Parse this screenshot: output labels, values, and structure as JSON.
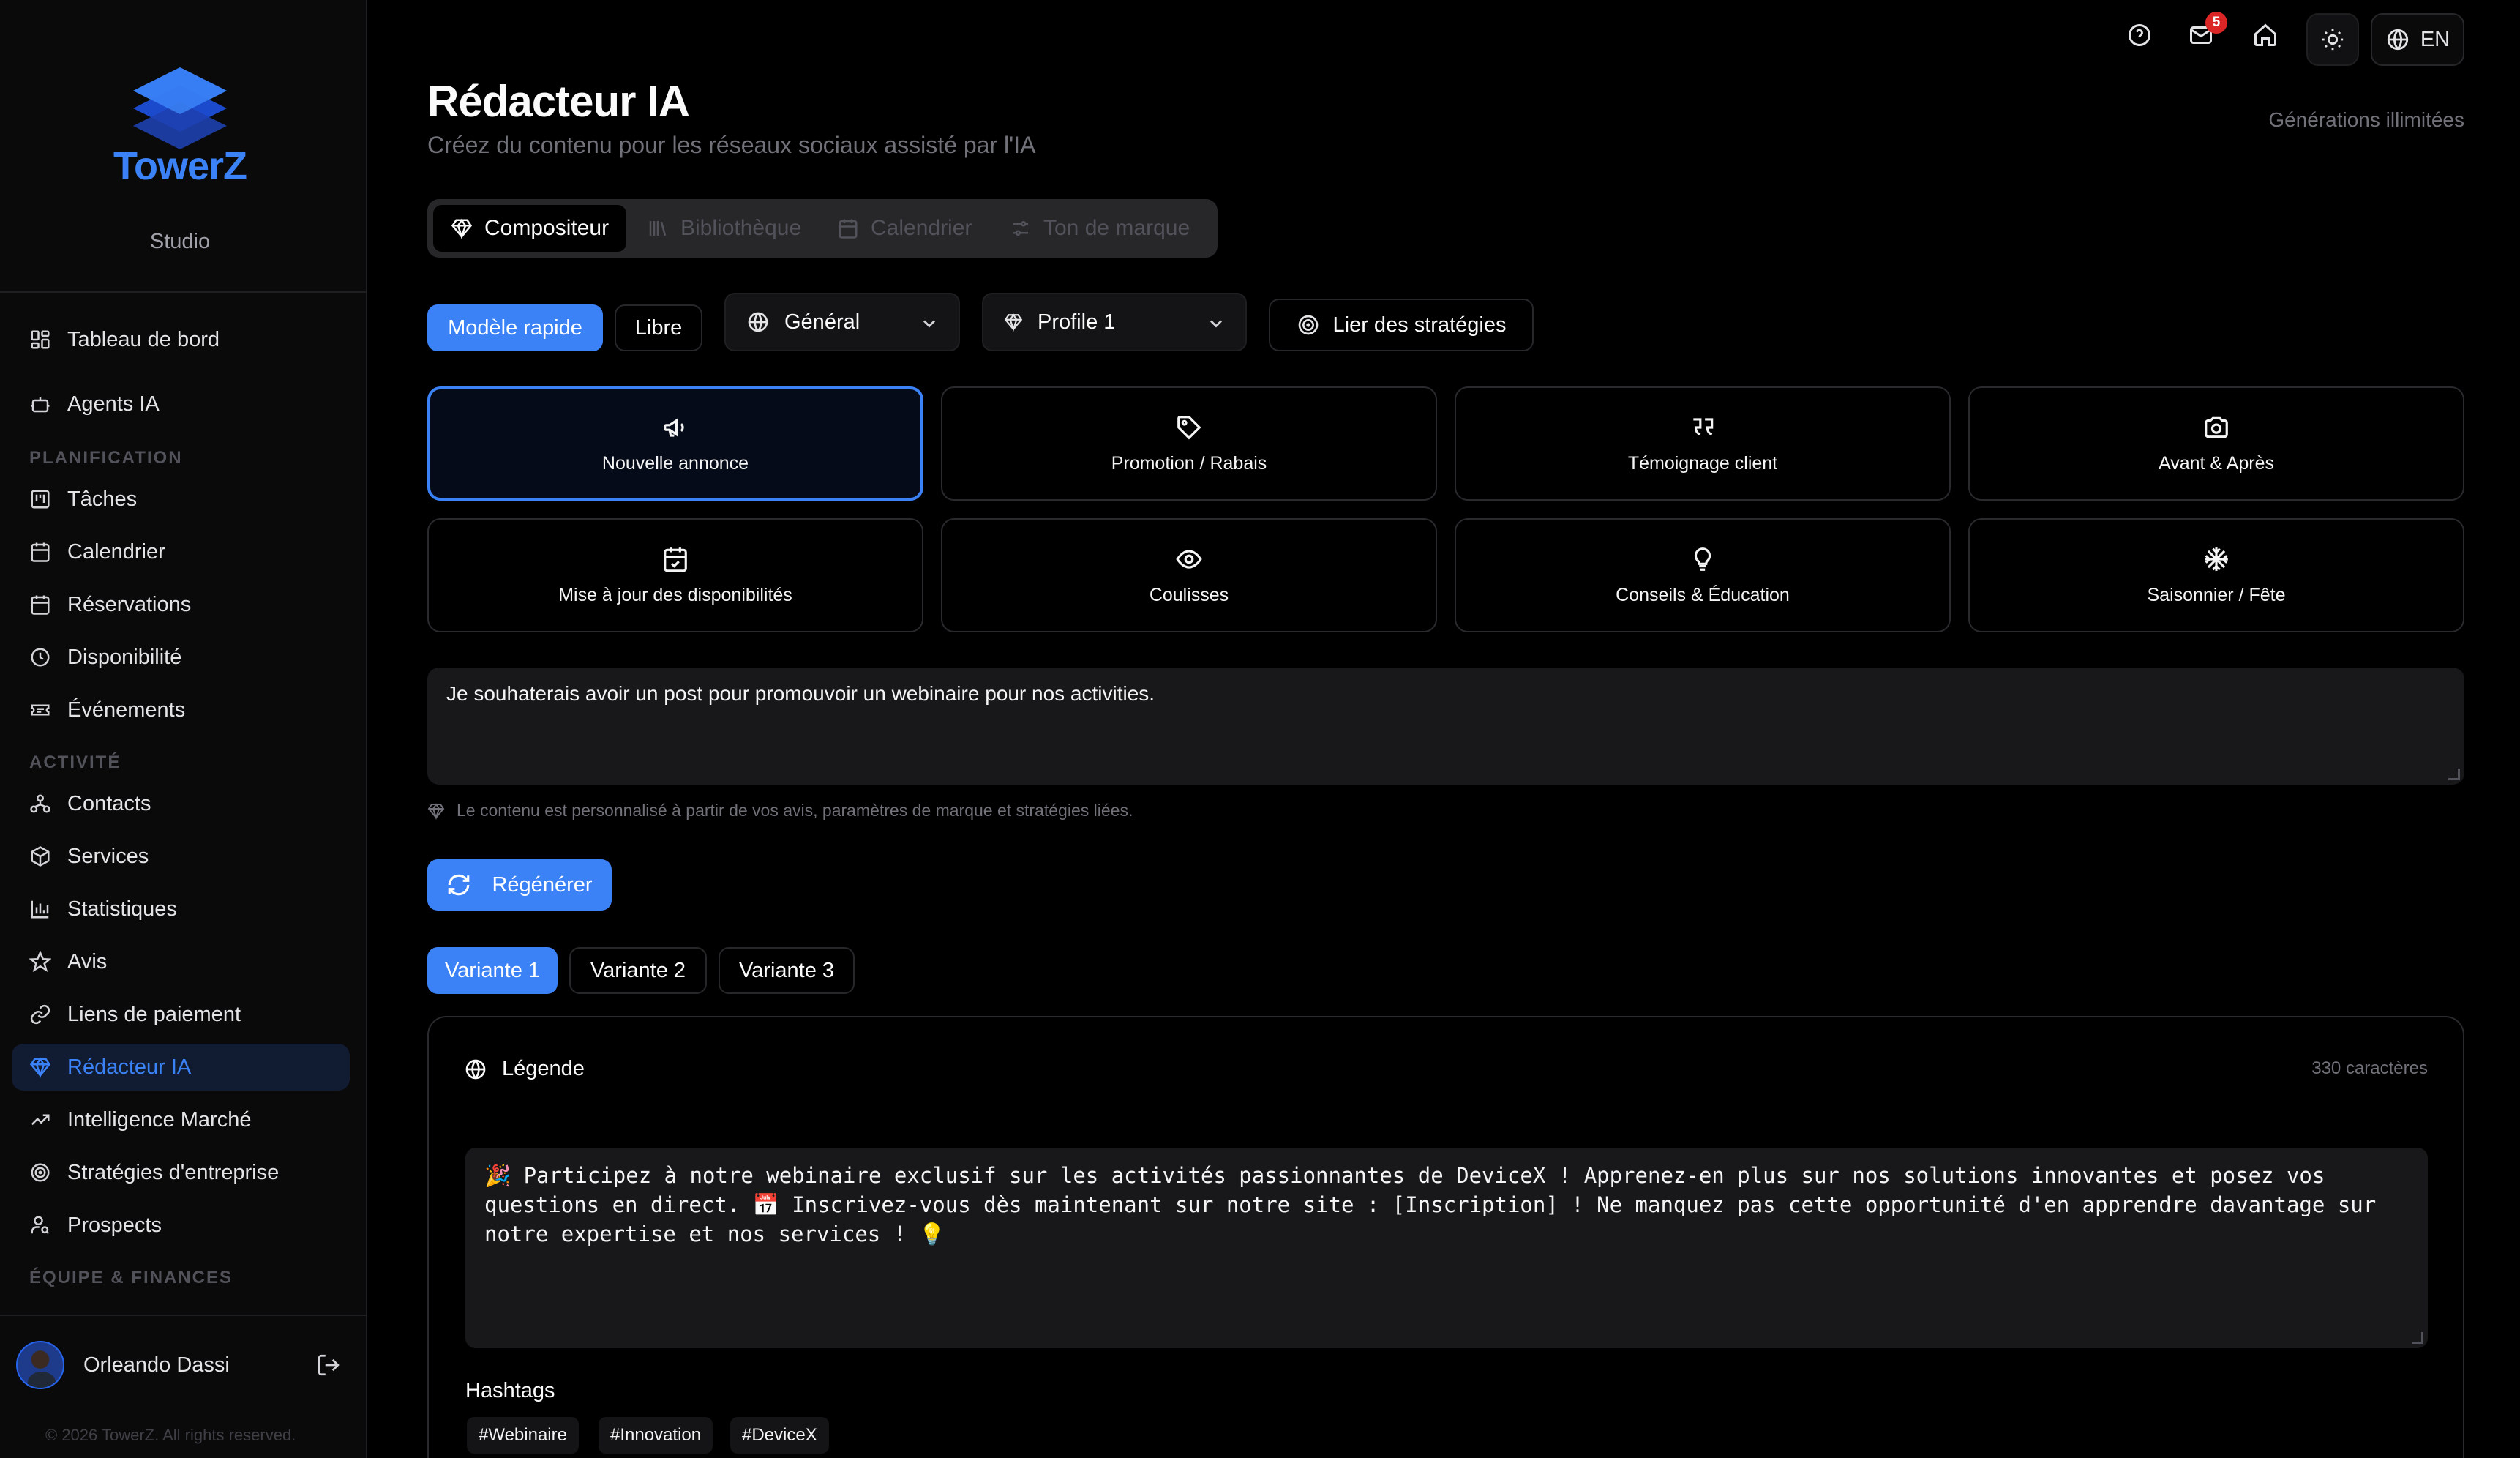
{
  "app": {
    "name": "TowerZ",
    "subtitle": "Studio",
    "copyright": "© 2026 TowerZ. All rights reserved.",
    "brand_color": "#3b82f6"
  },
  "topbar": {
    "notification_count": "5",
    "language": "EN"
  },
  "sidebar": {
    "items": [
      {
        "label": "Tableau de bord",
        "icon": "dashboard-icon"
      },
      {
        "label": "Agents IA",
        "icon": "bot-icon"
      },
      {
        "label": "Tâches",
        "icon": "kanban-icon"
      },
      {
        "label": "Calendrier",
        "icon": "calendar-icon"
      },
      {
        "label": "Réservations",
        "icon": "calendar-icon"
      },
      {
        "label": "Disponibilité",
        "icon": "clock-icon"
      },
      {
        "label": "Événements",
        "icon": "ticket-icon"
      },
      {
        "label": "Contacts",
        "icon": "users-icon"
      },
      {
        "label": "Services",
        "icon": "box-icon"
      },
      {
        "label": "Statistiques",
        "icon": "bar-chart-icon"
      },
      {
        "label": "Avis",
        "icon": "star-icon"
      },
      {
        "label": "Liens de paiement",
        "icon": "link-icon"
      },
      {
        "label": "Rédacteur IA",
        "icon": "gem-icon",
        "active": true
      },
      {
        "label": "Intelligence Marché",
        "icon": "trending-icon"
      },
      {
        "label": "Stratégies d'entreprise",
        "icon": "target-icon"
      },
      {
        "label": "Prospects",
        "icon": "user-search-icon"
      }
    ],
    "sections": [
      "PLANIFICATION",
      "ACTIVITÉ",
      "ÉQUIPE & FINANCES"
    ],
    "user": {
      "name": "Orleando Dassi"
    }
  },
  "header": {
    "title": "Rédacteur IA",
    "subtitle": "Créez du contenu pour les réseaux sociaux assisté par l'IA",
    "generations": "Générations illimitées"
  },
  "tabs": [
    {
      "label": "Compositeur",
      "active": true
    },
    {
      "label": "Bibliothèque"
    },
    {
      "label": "Calendrier"
    },
    {
      "label": "Ton de marque"
    }
  ],
  "controls": {
    "mode_quick": "Modèle rapide",
    "mode_free": "Libre",
    "category_select": "Général",
    "profile_select": "Profile 1",
    "link_strategies": "Lier des stratégies"
  },
  "templates": [
    {
      "label": "Nouvelle annonce",
      "icon": "megaphone-icon",
      "selected": true
    },
    {
      "label": "Promotion / Rabais",
      "icon": "tag-icon"
    },
    {
      "label": "Témoignage client",
      "icon": "quote-icon"
    },
    {
      "label": "Avant & Après",
      "icon": "camera-icon"
    },
    {
      "label": "Mise à jour des disponibilités",
      "icon": "calendar-check-icon"
    },
    {
      "label": "Coulisses",
      "icon": "eye-icon"
    },
    {
      "label": "Conseils & Éducation",
      "icon": "lightbulb-icon"
    },
    {
      "label": "Saisonnier / Fête",
      "icon": "snowflake-icon"
    }
  ],
  "prompt": {
    "value": "Je souhaterais avoir un post pour promouvoir un webinaire pour nos activities.",
    "hint": "Le contenu est personnalisé à partir de vos avis, paramètres de marque et stratégies liées."
  },
  "regenerate_label": "Régénérer",
  "variants": [
    "Variante 1",
    "Variante 2",
    "Variante 3"
  ],
  "result": {
    "title": "Légende",
    "char_count": "330 caractères",
    "caption": "🎉 Participez à notre webinaire exclusif sur les activités passionnantes de DeviceX ! Apprenez-en plus sur nos solutions innovantes et posez vos questions en direct. 📅 Inscrivez-vous dès maintenant sur notre site : [Inscription] ! Ne manquez pas cette opportunité d'en apprendre davantage sur notre expertise et nos services ! 💡",
    "hashtags_title": "Hashtags",
    "hashtags": [
      "#Webinaire",
      "#Innovation",
      "#DeviceX"
    ]
  }
}
